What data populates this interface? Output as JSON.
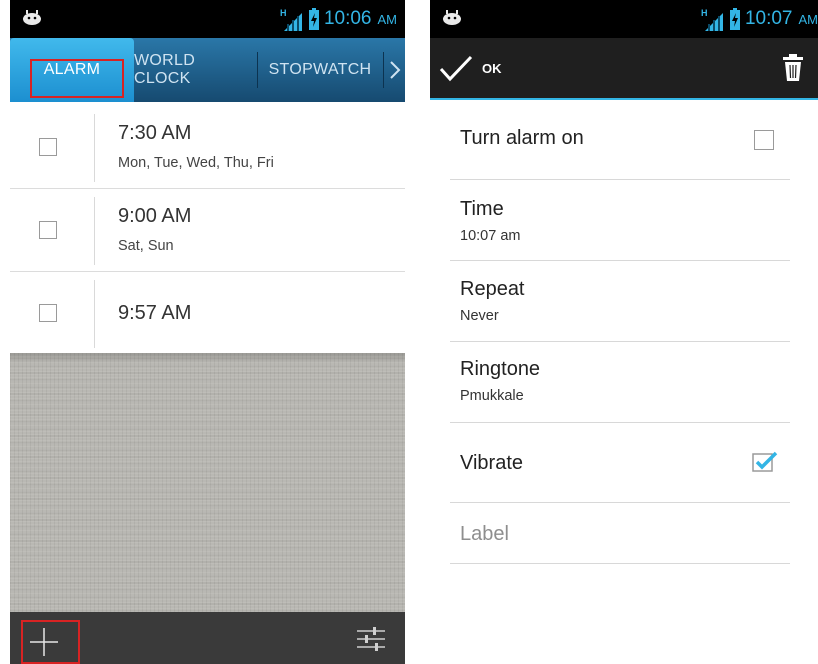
{
  "left_screen": {
    "status": {
      "time": "10:06",
      "ampm": "AM",
      "network": "H"
    },
    "tabs": [
      "ALARM",
      "WORLD CLOCK",
      "STOPWATCH"
    ],
    "alarms": [
      {
        "time": "7:30 AM",
        "days": "Mon, Tue, Wed, Thu, Fri",
        "enabled": false
      },
      {
        "time": "9:00 AM",
        "days": "Sat, Sun",
        "enabled": false
      },
      {
        "time": "9:57 AM",
        "days": "",
        "enabled": false
      }
    ],
    "icons": {
      "add": "add-icon",
      "settings": "sliders-icon",
      "next": "chevron-right-icon"
    }
  },
  "right_screen": {
    "status": {
      "time": "10:07",
      "ampm": "AM",
      "network": "H"
    },
    "actionbar": {
      "ok_label": "OK",
      "delete_icon": "trash-icon"
    },
    "prefs": {
      "turn_on": {
        "title": "Turn alarm on",
        "checked": false
      },
      "time": {
        "title": "Time",
        "value": "10:07 am"
      },
      "repeat": {
        "title": "Repeat",
        "value": "Never"
      },
      "ringtone": {
        "title": "Ringtone",
        "value": "Pmukkale"
      },
      "vibrate": {
        "title": "Vibrate",
        "checked": true
      },
      "label": {
        "title": "Label"
      }
    }
  },
  "colors": {
    "accent": "#33b5e5",
    "tab_bar": "#1f5c86",
    "highlight_box": "#d82323"
  }
}
